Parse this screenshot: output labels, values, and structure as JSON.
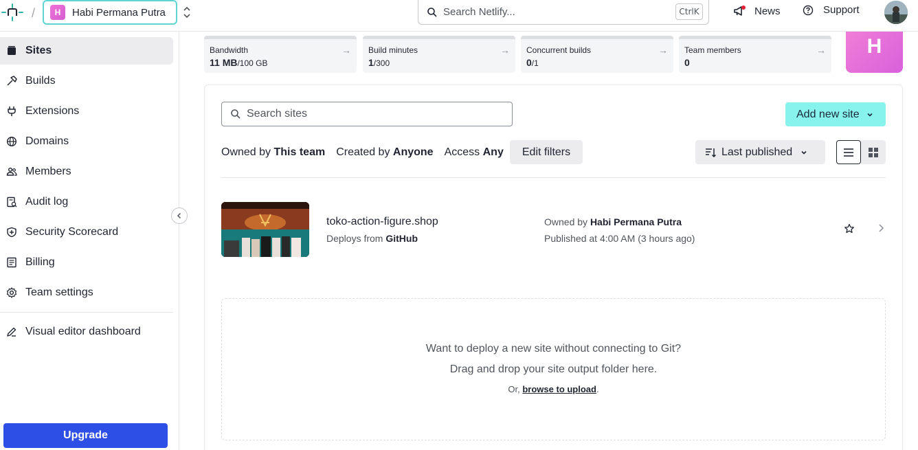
{
  "header": {
    "team_initial": "H",
    "team_name": "Habi Permana Putra",
    "search_placeholder": "Search Netlify...",
    "search_shortcut": "CtrlK",
    "news_label": "News",
    "support_label": "Support"
  },
  "sidebar": {
    "items": [
      {
        "label": "Sites",
        "icon": "sites-icon",
        "active": true
      },
      {
        "label": "Builds",
        "icon": "hammer-icon"
      },
      {
        "label": "Extensions",
        "icon": "plug-icon"
      },
      {
        "label": "Domains",
        "icon": "globe-icon"
      },
      {
        "label": "Members",
        "icon": "members-icon"
      },
      {
        "label": "Audit log",
        "icon": "audit-log-icon"
      },
      {
        "label": "Security Scorecard",
        "icon": "shield-icon"
      },
      {
        "label": "Billing",
        "icon": "billing-icon"
      },
      {
        "label": "Team settings",
        "icon": "gear-icon"
      }
    ],
    "visual_editor_label": "Visual editor dashboard",
    "upgrade_label": "Upgrade"
  },
  "usage": [
    {
      "label": "Bandwidth",
      "value": "11 MB",
      "limit": "/100 GB"
    },
    {
      "label": "Build minutes",
      "value": "1",
      "limit": "/300"
    },
    {
      "label": "Concurrent builds",
      "value": "0",
      "limit": "/1"
    },
    {
      "label": "Team members",
      "value": "0",
      "limit": ""
    }
  ],
  "team_avatar_initial": "H",
  "sites": {
    "search_placeholder": "Search sites",
    "add_button_label": "Add new site",
    "filters": {
      "owned_prefix": "Owned by",
      "owned_value": "This team",
      "created_prefix": "Created by",
      "created_value": "Anyone",
      "access_prefix": "Access",
      "access_value": "Any"
    },
    "edit_filters_label": "Edit filters",
    "sort_label": "Last published",
    "list": [
      {
        "name": "toko-action-figure.shop",
        "deploys_prefix": "Deploys from",
        "deploys_source": "GitHub",
        "owned_prefix": "Owned by",
        "owner": "Habi Permana Putra",
        "published": "Published at 4:00 AM (3 hours ago)"
      }
    ],
    "drop_zone": {
      "line1": "Want to deploy a new site without connecting to Git?",
      "line2": "Drag and drop your site output folder here.",
      "line3_prefix": "Or,",
      "line3_link": "browse to upload",
      "line3_suffix": "."
    }
  },
  "colors": {
    "accent_teal": "#88f2ec",
    "upgrade_blue": "#2e4fe6",
    "team_pink": "#e06bd8"
  }
}
